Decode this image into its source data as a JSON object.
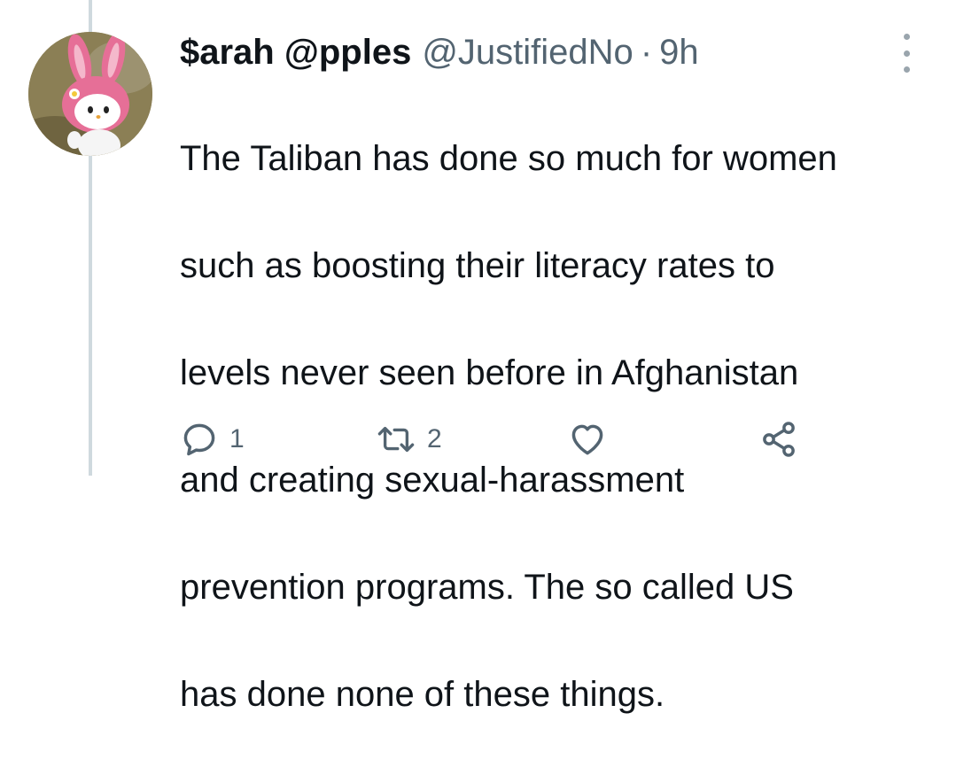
{
  "tweet": {
    "author": {
      "display_name": "$arah @pples",
      "handle": "@JustifiedNo",
      "avatar_icon": "pink-bunny-hood-character-avatar"
    },
    "separator": "·",
    "timestamp": "9h",
    "text_lines": [
      "The Taliban has done so much for women",
      "such as boosting their literacy rates to",
      "levels never seen before in Afghanistan",
      "and creating sexual-harassment",
      "prevention programs. The so called US",
      "has done none of these things."
    ],
    "actions": {
      "reply": {
        "icon": "reply-icon",
        "count": "1"
      },
      "retweet": {
        "icon": "retweet-icon",
        "count": "2"
      },
      "like": {
        "icon": "heart-icon",
        "count": ""
      },
      "share": {
        "icon": "share-icon"
      }
    },
    "more_icon": "more-options-icon"
  },
  "colors": {
    "text": "#0f1419",
    "secondary": "#536471",
    "thread_line": "#cfd9de",
    "avatar_pink": "#e8729a"
  }
}
